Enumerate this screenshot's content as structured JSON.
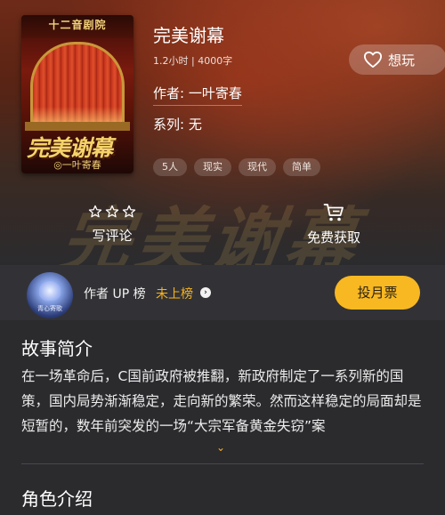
{
  "book": {
    "title": "完美谢幕",
    "meta": "1.2小时 | 4000字",
    "author_line": "作者: 一叶寄春",
    "series_line": "系列: 无",
    "tags": [
      "5人",
      "现实",
      "现代",
      "简单"
    ]
  },
  "cover": {
    "theater_sign": "十二音剧院",
    "title": "完美谢幕",
    "author": "◎一叶寄春"
  },
  "hero_watermark": "完美谢幕",
  "want_button": {
    "label": "想玩",
    "icon": "heart-outline-icon"
  },
  "actions": {
    "review": {
      "label": "写评论",
      "icon": "star-outline-icon"
    },
    "free": {
      "label": "免费获取",
      "icon": "cart-icon"
    }
  },
  "up_bar": {
    "avatar_caption": "青心寄歌",
    "label": "作者 UP 榜",
    "status": "未上榜",
    "vote_button": "投月票"
  },
  "synopsis": {
    "title": "故事简介",
    "text": "在一场革命后，C国前政府被推翻，新政府制定了一系列新的国策，国内局势渐渐稳定，走向新的繁荣。然而这样稳定的局面却是短暂的，数年前突发的一场“大宗军备黄金失窃”案"
  },
  "roles": {
    "title": "角色介绍"
  },
  "colors": {
    "accent": "#f7b21e",
    "vote_button": "#f8b822",
    "background": "#2b2b2e"
  }
}
